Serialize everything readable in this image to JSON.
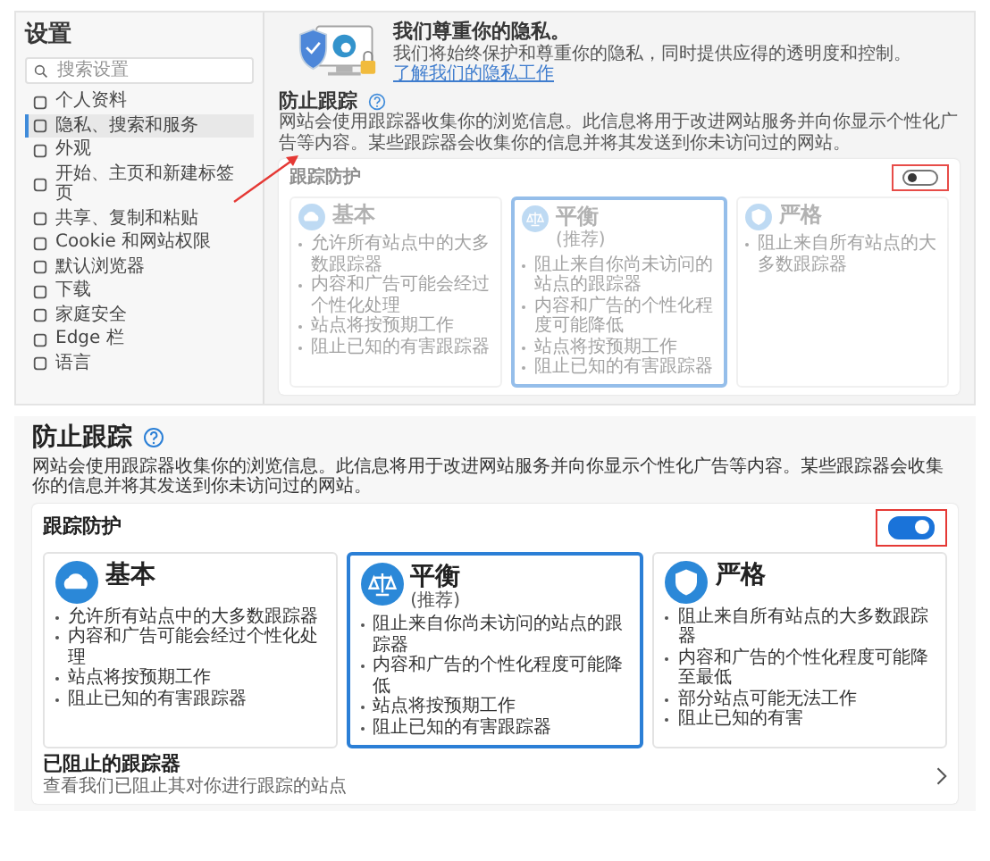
{
  "settings_screenshot": {
    "sidebar": {
      "title": "设置",
      "search": {
        "placeholder": "搜索设置"
      },
      "items": [
        {
          "label": "个人资料",
          "selected": false
        },
        {
          "label": "隐私、搜索和服务",
          "selected": true
        },
        {
          "label": "外观",
          "selected": false
        },
        {
          "label": "开始、主页和新建标签页",
          "selected": false
        },
        {
          "label": "共享、复制和粘贴",
          "selected": false
        },
        {
          "label": "Cookie 和网站权限",
          "selected": false
        },
        {
          "label": "默认浏览器",
          "selected": false
        },
        {
          "label": "下载",
          "selected": false
        },
        {
          "label": "家庭安全",
          "selected": false
        },
        {
          "label": "Edge 栏",
          "selected": false
        },
        {
          "label": "语言",
          "selected": false
        }
      ]
    },
    "banner": {
      "title": "我们尊重你的隐私。",
      "text": "我们将始终保护和尊重你的隐私，同时提供应得的透明度和控制。",
      "link": "了解我们的隐私工作"
    },
    "tracking": {
      "heading": "防止跟踪",
      "description": "网站会使用跟踪器收集你的浏览信息。此信息将用于改进网站服务并向你显示个性化广告等内容。某些跟踪器会收集你的信息并将其发送到你未访问过的网站。",
      "toggle_label": "跟踪防护",
      "on": false,
      "levels": [
        {
          "kind": "basic",
          "title": "基本",
          "selected": false,
          "bullets": [
            "允许所有站点中的大多数跟踪器",
            "内容和广告可能会经过个性化处理",
            "站点将按预期工作",
            "阻止已知的有害跟踪器"
          ]
        },
        {
          "kind": "balanced",
          "title": "平衡",
          "subtitle": "(推荐)",
          "selected": true,
          "bullets": [
            "阻止来自你尚未访问的站点的跟踪器",
            "内容和广告的个性化程度可能降低",
            "站点将按预期工作",
            "阻止已知的有害跟踪器"
          ]
        },
        {
          "kind": "strict",
          "title": "严格",
          "selected": false,
          "bullets": [
            "阻止来自所有站点的大多数跟踪器"
          ]
        }
      ]
    }
  },
  "tracking_detail": {
    "heading": "防止跟踪",
    "description": "网站会使用跟踪器收集你的浏览信息。此信息将用于改进网站服务并向你显示个性化广告等内容。某些跟踪器会收集你的信息并将其发送到你未访问过的网站。",
    "toggle_label": "跟踪防护",
    "on": true,
    "levels": [
      {
        "kind": "basic",
        "title": "基本",
        "selected": false,
        "bullets": [
          "允许所有站点中的大多数跟踪器",
          "内容和广告可能会经过个性化处理",
          "站点将按预期工作",
          "阻止已知的有害跟踪器"
        ]
      },
      {
        "kind": "balanced",
        "title": "平衡",
        "subtitle": "(推荐)",
        "selected": true,
        "bullets": [
          "阻止来自你尚未访问的站点的跟踪器",
          "内容和广告的个性化程度可能降低",
          "站点将按预期工作",
          "阻止已知的有害跟踪器"
        ]
      },
      {
        "kind": "strict",
        "title": "严格",
        "selected": false,
        "bullets": [
          "阻止来自所有站点的大多数跟踪器",
          "内容和广告的个性化程度可能降至最低",
          "部分站点可能无法工作",
          "阻止已知的有害"
        ]
      }
    ],
    "blocked": {
      "title": "已阻止的跟踪器",
      "subtitle": "查看我们已阻止其对你进行跟踪的站点"
    }
  }
}
